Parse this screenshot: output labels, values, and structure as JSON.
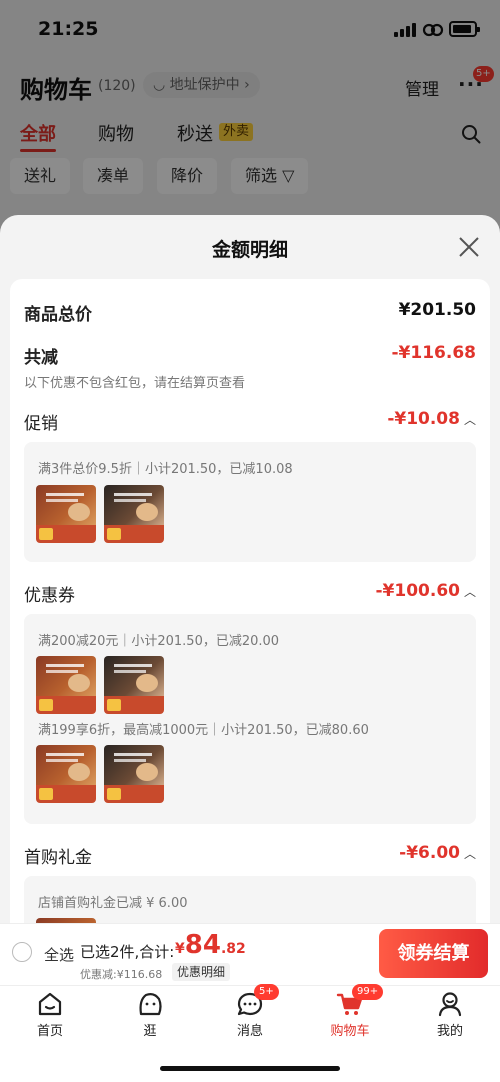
{
  "status_bar": {
    "time": "21:25"
  },
  "background_page": {
    "title": "购物车",
    "count": "(120)",
    "address_pill": "◡ 地址保护中 ›",
    "manage": "管理",
    "more_dots": "···",
    "more_badge": "5+",
    "tabs": [
      "全部",
      "购物",
      "秒送"
    ],
    "takeout_tag": "外卖",
    "filter_chips": [
      "送礼",
      "凑单",
      "降价",
      "筛选 ▽"
    ]
  },
  "sheet": {
    "title": "金额明细",
    "goods_total": {
      "label": "商品总价",
      "value": "¥201.50"
    },
    "total_reduction": {
      "label": "共减",
      "value": "-¥116.68"
    },
    "note": "以下优惠不包含红包，请在结算页查看",
    "promotion": {
      "label": "促销",
      "value": "-¥10.08",
      "lines": [
        "满3件总价9.5折｜小计201.50，已减10.08"
      ]
    },
    "coupon": {
      "label": "优惠券",
      "value": "-¥100.60",
      "lines": [
        "满200减20元｜小计201.50，已减20.00",
        "满199享6折，最高减1000元｜小计201.50，已减80.60"
      ]
    },
    "first_purchase": {
      "label": "首购礼金",
      "value": "-¥6.00",
      "lines": [
        "店铺首购礼金已减 ¥ 6.00"
      ]
    }
  },
  "bottom_bar": {
    "select_all": "全选",
    "selected": "已选2件,合计:",
    "total_currency": "¥",
    "total_int": "84",
    "total_dec": ".82",
    "discount": "优惠减:¥116.68",
    "detail_link": "优惠明细",
    "checkout_button": "领券结算"
  },
  "tabbar": {
    "items": [
      {
        "label": "首页"
      },
      {
        "label": "逛"
      },
      {
        "label": "消息",
        "badge": "5+"
      },
      {
        "label": "购物车",
        "badge": "99+"
      },
      {
        "label": "我的"
      }
    ]
  },
  "colors": {
    "accent": "#e0342c",
    "badge": "#ff3b30",
    "takeout": "#ffd23c"
  },
  "icons": [
    "search-icon",
    "close-icon",
    "home-icon",
    "explore-icon",
    "message-icon",
    "cart-icon",
    "profile-icon"
  ]
}
